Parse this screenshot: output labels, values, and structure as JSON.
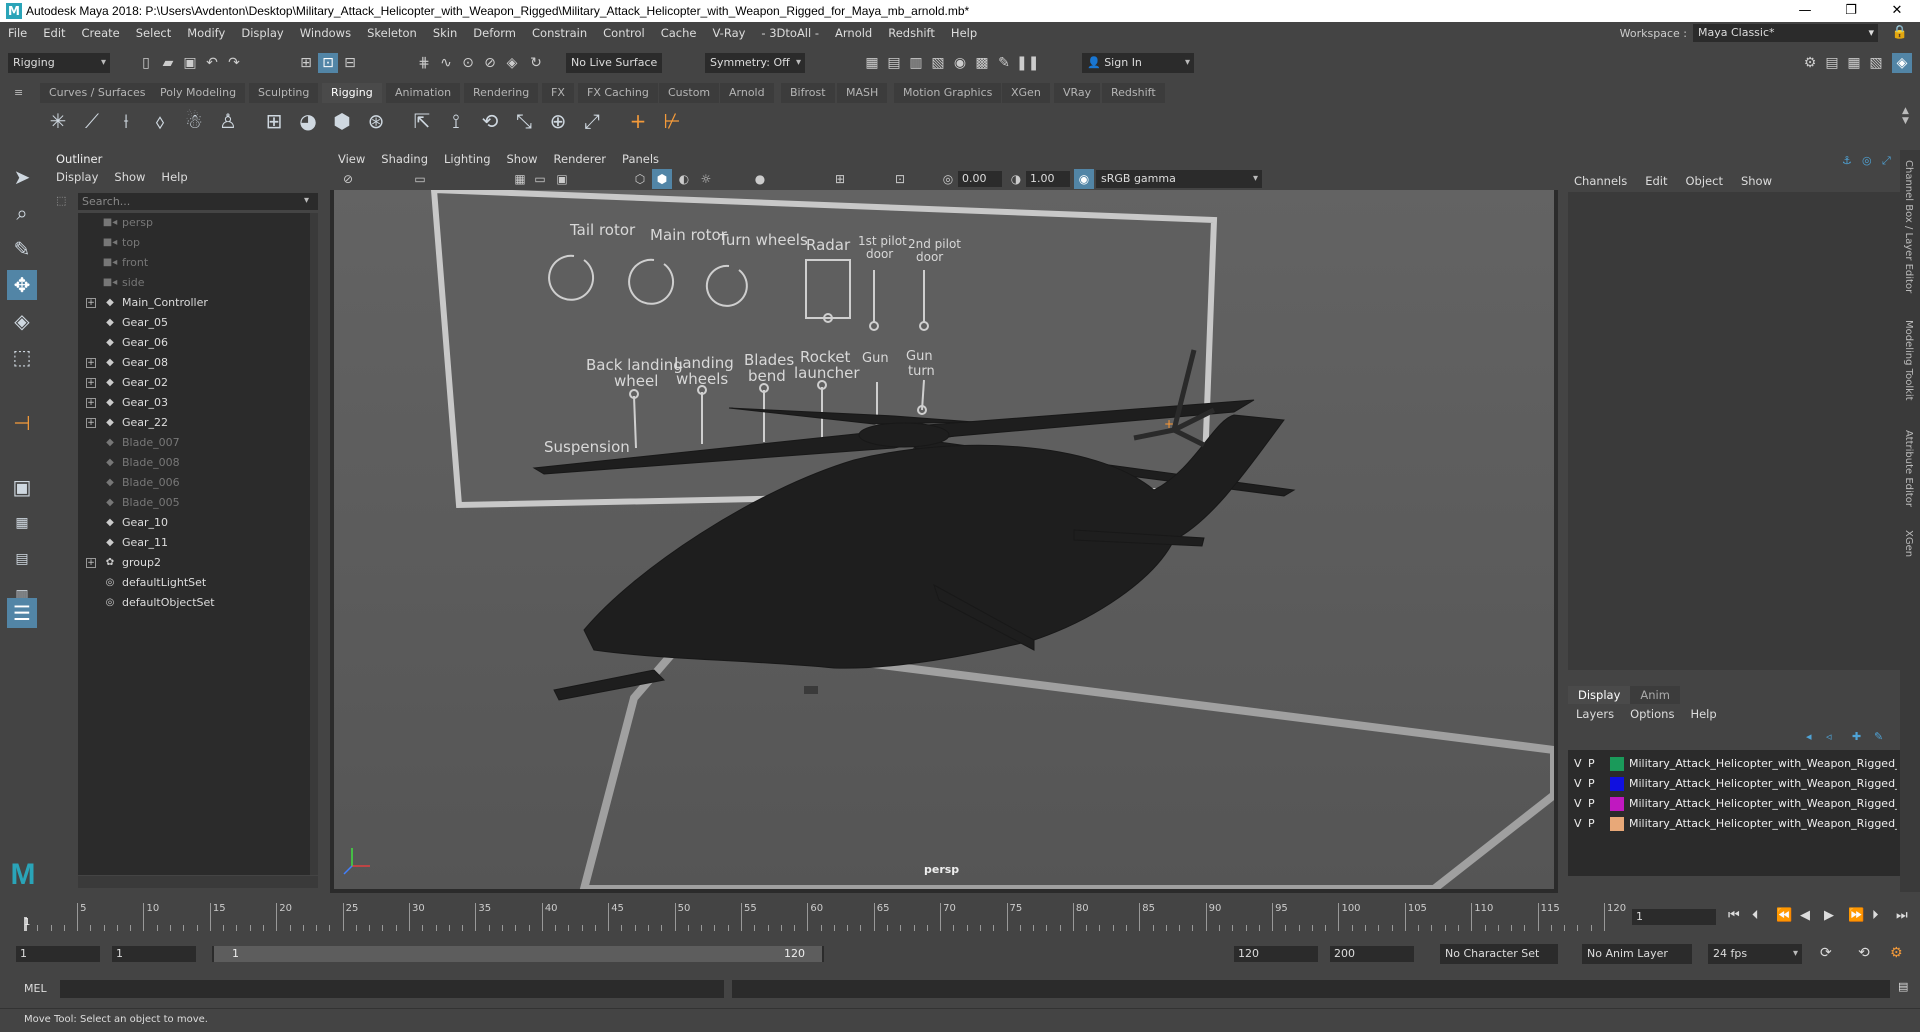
{
  "window": {
    "title": "Autodesk Maya 2018: P:\\Users\\Avdenton\\Desktop\\Military_Attack_Helicopter_with_Weapon_Rigged\\Military_Attack_Helicopter_with_Weapon_Rigged_for_Maya_mb_arnold.mb*",
    "logo": "M"
  },
  "menubar": {
    "items": [
      "File",
      "Edit",
      "Create",
      "Select",
      "Modify",
      "Display",
      "Windows",
      "Skeleton",
      "Skin",
      "Deform",
      "Constrain",
      "Control",
      "Cache",
      "V-Ray",
      "- 3DtoAll -",
      "Arnold",
      "Redshift",
      "Help"
    ],
    "workspace_label": "Workspace :",
    "workspace_value": "Maya Classic*"
  },
  "statusline": {
    "mode": "Rigging",
    "live_surface": "No Live Surface",
    "symmetry": "Symmetry: Off",
    "sign_in": "Sign In"
  },
  "shelf": {
    "tabs": [
      "Curves / Surfaces",
      "Poly Modeling",
      "Sculpting",
      "Rigging",
      "Animation",
      "Rendering",
      "FX",
      "FX Caching",
      "Custom",
      "Arnold",
      "Bifrost",
      "MASH",
      "Motion Graphics",
      "XGen",
      "VRay",
      "Redshift"
    ],
    "active_tab": "Rigging"
  },
  "outliner": {
    "title": "Outliner",
    "menus": [
      "Display",
      "Show",
      "Help"
    ],
    "search_placeholder": "Search...",
    "items": [
      {
        "label": "persp",
        "icon": "camera-icon",
        "dim": true,
        "expand": false
      },
      {
        "label": "top",
        "icon": "camera-icon",
        "dim": true,
        "expand": false
      },
      {
        "label": "front",
        "icon": "camera-icon",
        "dim": true,
        "expand": false
      },
      {
        "label": "side",
        "icon": "camera-icon",
        "dim": true,
        "expand": false
      },
      {
        "label": "Main_Controller",
        "icon": "transform-icon",
        "dim": false,
        "expand": true
      },
      {
        "label": "Gear_05",
        "icon": "transform-icon",
        "dim": false,
        "expand": false
      },
      {
        "label": "Gear_06",
        "icon": "transform-icon",
        "dim": false,
        "expand": false
      },
      {
        "label": "Gear_08",
        "icon": "transform-icon",
        "dim": false,
        "expand": true
      },
      {
        "label": "Gear_02",
        "icon": "transform-icon",
        "dim": false,
        "expand": true
      },
      {
        "label": "Gear_03",
        "icon": "transform-icon",
        "dim": false,
        "expand": true
      },
      {
        "label": "Gear_22",
        "icon": "transform-icon",
        "dim": false,
        "expand": true
      },
      {
        "label": "Blade_007",
        "icon": "transform-icon",
        "dim": true,
        "expand": false
      },
      {
        "label": "Blade_008",
        "icon": "transform-icon",
        "dim": true,
        "expand": false
      },
      {
        "label": "Blade_006",
        "icon": "transform-icon",
        "dim": true,
        "expand": false
      },
      {
        "label": "Blade_005",
        "icon": "transform-icon",
        "dim": true,
        "expand": false
      },
      {
        "label": "Gear_10",
        "icon": "transform-icon",
        "dim": false,
        "expand": false
      },
      {
        "label": "Gear_11",
        "icon": "transform-icon",
        "dim": false,
        "expand": false
      },
      {
        "label": "group2",
        "icon": "group-icon",
        "dim": false,
        "expand": true
      },
      {
        "label": "defaultLightSet",
        "icon": "set-icon",
        "dim": false,
        "expand": false
      },
      {
        "label": "defaultObjectSet",
        "icon": "set-icon",
        "dim": false,
        "expand": false
      }
    ]
  },
  "viewport": {
    "menus": [
      "View",
      "Shading",
      "Lighting",
      "Show",
      "Renderer",
      "Panels"
    ],
    "exposure": "0.00",
    "gamma": "1.00",
    "color_space": "sRGB gamma",
    "camera_label": "persp",
    "board_labels": {
      "tail_rotor": "Tail rotor",
      "main_rotor": "Main rotor",
      "turn_wheels": "Turn wheels",
      "radar": "Radar",
      "pilot1": "1st pilot",
      "pilot1b": "door",
      "pilot2": "2nd pilot",
      "pilot2b": "door",
      "back_landing": "Back landing",
      "back_landing_b": "wheel",
      "landing": "Landing",
      "landing_b": "wheels",
      "blades": "Blades",
      "blades_b": "bend",
      "rocket": "Rocket",
      "rocket_b": "launcher",
      "gun": "Gun",
      "gun_turn": "Gun",
      "gun_turn_b": "turn",
      "suspension": "Suspension"
    }
  },
  "channelbox": {
    "menus": [
      "Channels",
      "Edit",
      "Object",
      "Show"
    ],
    "tabs": [
      "Display",
      "Anim"
    ],
    "layer_menus": [
      "Layers",
      "Options",
      "Help"
    ],
    "layers": [
      {
        "v": "V",
        "p": "P",
        "color": "#1a9a5a",
        "name": "Military_Attack_Helicopter_with_Weapon_Rigged_Bo"
      },
      {
        "v": "V",
        "p": "P",
        "color": "#1010e0",
        "name": "Military_Attack_Helicopter_with_Weapon_Rigged_Ge"
      },
      {
        "v": "V",
        "p": "P",
        "color": "#c018c0",
        "name": "Military_Attack_Helicopter_with_Weapon_Rigged_Co"
      },
      {
        "v": "V",
        "p": "P",
        "color": "#e8a878",
        "name": "Military_Attack_Helicopter_with_Weapon_Rigged_He"
      }
    ],
    "side_tabs": [
      "Channel Box / Layer Editor",
      "Modeling Toolkit",
      "Attribute Editor",
      "XGen"
    ]
  },
  "timeslider": {
    "ticks": [
      "5",
      "10",
      "15",
      "20",
      "25",
      "30",
      "35",
      "40",
      "45",
      "50",
      "55",
      "60",
      "65",
      "70",
      "75",
      "80",
      "85",
      "90",
      "95",
      "100",
      "105",
      "110",
      "115",
      "120"
    ],
    "current_frame_label": "1",
    "current_frame_field": "1"
  },
  "rangebar": {
    "start_field": "1",
    "anim_start_field": "1",
    "range_start": "1",
    "range_end": "120",
    "end_field": "120",
    "anim_end_field": "200",
    "character_set": "No Character Set",
    "anim_layer": "No Anim Layer",
    "fps": "24 fps"
  },
  "cmdline": {
    "label": "MEL"
  },
  "helpline": {
    "text": "Move Tool: Select an object to move."
  }
}
